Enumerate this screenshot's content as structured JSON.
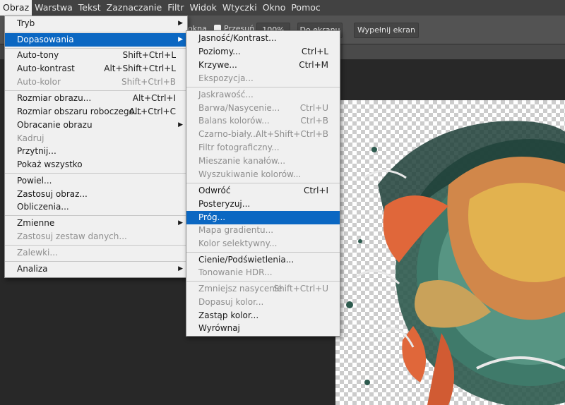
{
  "menubar": [
    "Obraz",
    "Warstwa",
    "Tekst",
    "Zaznaczanie",
    "Filtr",
    "Widok",
    "Wtyczki",
    "Okno",
    "Pomoc"
  ],
  "optionsbar": {
    "label_fit": "okna",
    "scrub_label": "Przesuń",
    "zoom_btn": "100%",
    "fit_screen_btn": "Do ekranu",
    "fill_screen_btn": "Wypełnij ekran"
  },
  "image_menu": {
    "items": [
      {
        "label": "Tryb",
        "shortcut": "",
        "submenu": true,
        "disabled": false
      },
      {
        "label": "Dopasowania",
        "shortcut": "",
        "submenu": true,
        "disabled": false,
        "highlighted": true
      },
      {
        "label": "Auto-tony",
        "shortcut": "Shift+Ctrl+L",
        "disabled": false
      },
      {
        "label": "Auto-kontrast",
        "shortcut": "Alt+Shift+Ctrl+L",
        "disabled": false
      },
      {
        "label": "Auto-kolor",
        "shortcut": "Shift+Ctrl+B",
        "disabled": true
      },
      {
        "label": "Rozmiar obrazu...",
        "shortcut": "Alt+Ctrl+I",
        "disabled": false
      },
      {
        "label": "Rozmiar obszaru roboczego...",
        "shortcut": "Alt+Ctrl+C",
        "disabled": false
      },
      {
        "label": "Obracanie obrazu",
        "shortcut": "",
        "submenu": true,
        "disabled": false
      },
      {
        "label": "Kadruj",
        "shortcut": "",
        "disabled": true
      },
      {
        "label": "Przytnij...",
        "shortcut": "",
        "disabled": false
      },
      {
        "label": "Pokaż wszystko",
        "shortcut": "",
        "disabled": false
      },
      {
        "label": "Powiel...",
        "shortcut": "",
        "disabled": false
      },
      {
        "label": "Zastosuj obraz...",
        "shortcut": "",
        "disabled": false
      },
      {
        "label": "Obliczenia...",
        "shortcut": "",
        "disabled": false
      },
      {
        "label": "Zmienne",
        "shortcut": "",
        "submenu": true,
        "disabled": false
      },
      {
        "label": "Zastosuj zestaw danych...",
        "shortcut": "",
        "disabled": true
      },
      {
        "label": "Zalewki...",
        "shortcut": "",
        "disabled": true
      },
      {
        "label": "Analiza",
        "shortcut": "",
        "submenu": true,
        "disabled": false
      }
    ]
  },
  "adjustments_menu": {
    "items": [
      {
        "label": "Jasność/Kontrast...",
        "shortcut": "",
        "disabled": false
      },
      {
        "label": "Poziomy...",
        "shortcut": "Ctrl+L",
        "disabled": false
      },
      {
        "label": "Krzywe...",
        "shortcut": "Ctrl+M",
        "disabled": false
      },
      {
        "label": "Ekspozycja...",
        "shortcut": "",
        "disabled": true
      },
      {
        "label": "Jaskrawość...",
        "shortcut": "",
        "disabled": true
      },
      {
        "label": "Barwa/Nasycenie...",
        "shortcut": "Ctrl+U",
        "disabled": true
      },
      {
        "label": "Balans kolorów...",
        "shortcut": "Ctrl+B",
        "disabled": true
      },
      {
        "label": "Czarno-biały...",
        "shortcut": "Alt+Shift+Ctrl+B",
        "disabled": true
      },
      {
        "label": "Filtr fotograficzny...",
        "shortcut": "",
        "disabled": true
      },
      {
        "label": "Mieszanie kanałów...",
        "shortcut": "",
        "disabled": true
      },
      {
        "label": "Wyszukiwanie kolorów...",
        "shortcut": "",
        "disabled": true
      },
      {
        "label": "Odwróć",
        "shortcut": "Ctrl+I",
        "disabled": false
      },
      {
        "label": "Posteryzuj...",
        "shortcut": "",
        "disabled": false
      },
      {
        "label": "Próg...",
        "shortcut": "",
        "disabled": false,
        "highlighted": true
      },
      {
        "label": "Mapa gradientu...",
        "shortcut": "",
        "disabled": true
      },
      {
        "label": "Kolor selektywny...",
        "shortcut": "",
        "disabled": true
      },
      {
        "label": "Cienie/Podświetlenia...",
        "shortcut": "",
        "disabled": false
      },
      {
        "label": "Tonowanie HDR...",
        "shortcut": "",
        "disabled": true
      },
      {
        "label": "Zmniejsz nasycenie",
        "shortcut": "Shift+Ctrl+U",
        "disabled": true
      },
      {
        "label": "Dopasuj kolor...",
        "shortcut": "",
        "disabled": true
      },
      {
        "label": "Zastąp kolor...",
        "shortcut": "",
        "disabled": false
      },
      {
        "label": "Wyrównaj",
        "shortcut": "",
        "disabled": false
      }
    ]
  },
  "colors": {
    "highlight": "#0b67c2",
    "menu_bg": "#f0f0f0",
    "disabled_text": "#8e8e8e",
    "app_bg": "#282828"
  }
}
